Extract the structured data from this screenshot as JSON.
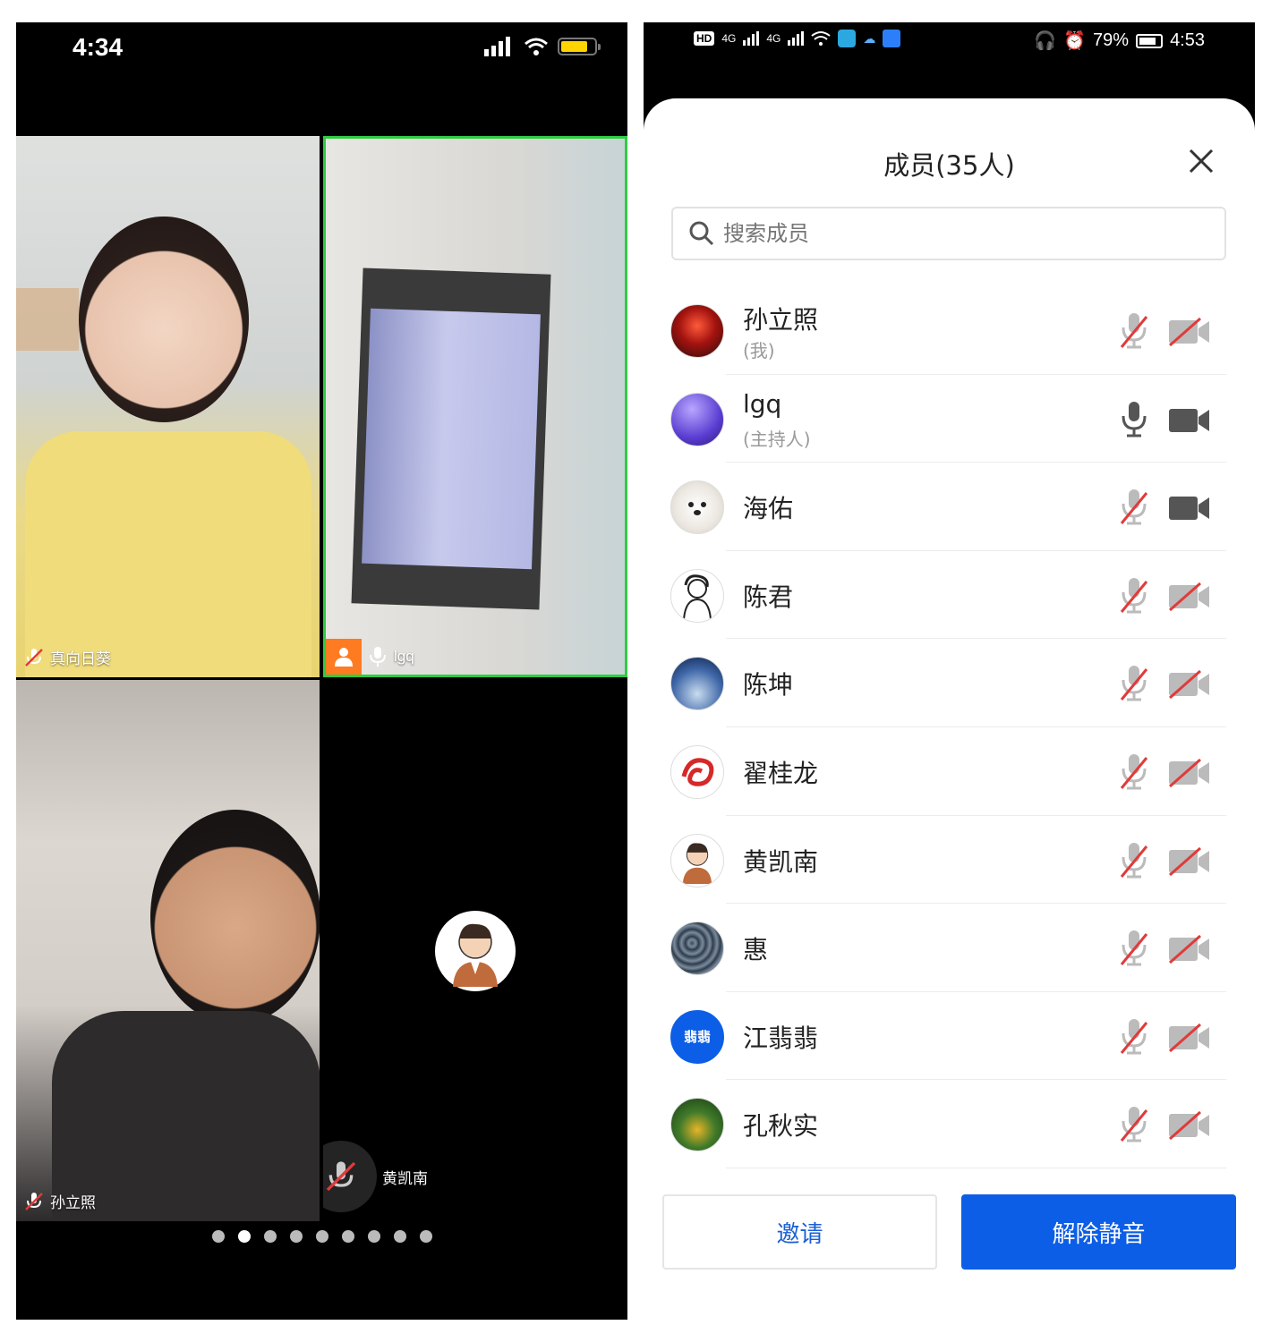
{
  "left_screen": {
    "status": {
      "time": "4:34"
    },
    "tiles": [
      {
        "name": "真向日葵",
        "mic": "muted"
      },
      {
        "name": "lgq",
        "mic": "on",
        "role_icon": "host-person-icon",
        "active_speaker_color": "#2ecc40"
      },
      {
        "name": "孙立照",
        "mic": "muted"
      },
      {
        "name": "黄凯南",
        "mic": "muted",
        "video": "off"
      }
    ],
    "pager": {
      "total": 9,
      "active_index": 1
    }
  },
  "right_screen": {
    "status": {
      "left_icons": [
        "HD",
        "4G",
        "4G",
        "wifi",
        "app-icon",
        "cloud-icon",
        "app-icon"
      ],
      "battery": "79%",
      "time": "4:53"
    },
    "title": "成员(35人)",
    "search": {
      "placeholder": "搜索成员"
    },
    "members": [
      {
        "name": "孙立照",
        "sub": "(我)",
        "mic": "muted",
        "camera": "off",
        "avatar": "sunset-avatar"
      },
      {
        "name": "lgq",
        "sub": "(主持人)",
        "mic": "on",
        "camera": "on",
        "avatar": "purple-avatar"
      },
      {
        "name": "海佑",
        "sub": "",
        "mic": "muted",
        "camera": "on",
        "avatar": "seal-avatar"
      },
      {
        "name": "陈君",
        "sub": "",
        "mic": "muted",
        "camera": "off",
        "avatar": "sketch-avatar"
      },
      {
        "name": "陈坤",
        "sub": "",
        "mic": "muted",
        "camera": "off",
        "avatar": "space-avatar"
      },
      {
        "name": "翟桂龙",
        "sub": "",
        "mic": "muted",
        "camera": "off",
        "avatar": "dragon-avatar"
      },
      {
        "name": "黄凯南",
        "sub": "",
        "mic": "muted",
        "camera": "off",
        "avatar": "cartoon-avatar"
      },
      {
        "name": "惠",
        "sub": "",
        "mic": "muted",
        "camera": "off",
        "avatar": "pattern-avatar"
      },
      {
        "name": "江翡翡",
        "sub": "",
        "mic": "muted",
        "camera": "off",
        "avatar": "initials-avatar",
        "initials": "翡翡"
      },
      {
        "name": "孔秋实",
        "sub": "",
        "mic": "muted",
        "camera": "off",
        "avatar": "nature-avatar"
      }
    ],
    "buttons": {
      "invite": "邀请",
      "unmute_all": "解除静音"
    },
    "colors": {
      "primary": "#0c5ee6",
      "muted_red": "#e03b3b",
      "icon_gray": "#555555"
    }
  }
}
